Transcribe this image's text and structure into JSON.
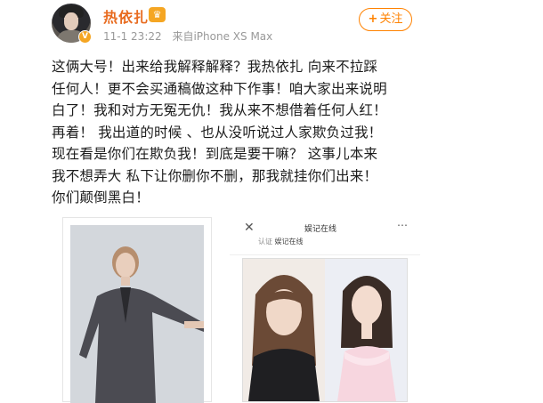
{
  "post": {
    "username": "热依扎",
    "timestamp": "11-1 23:22",
    "source": "来自iPhone XS Max",
    "follow_label": "关注",
    "text_lines": [
      "这俩大号！出来给我解释解释？我热依扎 向来不拉踩",
      "任何人！更不会买通稿做这种下作事！咱大家出来说明",
      "白了！我和对方无冤无仇！我从来不想借着任何人红！",
      "再着！ 我出道的时候 、也从没听说过人家欺负过我！",
      "现在看是你们在欺负我！到底是要干嘛？ 这事儿本来",
      "我不想弄大 私下让你删你不删，那我就挂你们出来！",
      "你们颠倒黑白！"
    ]
  },
  "screenshot": {
    "nav_title": "娱记在线",
    "sub_prefix": "认证",
    "sub_account": "娱记在线"
  },
  "colors": {
    "username": "#e86b1f",
    "follow": "#ff8200",
    "meta": "#999999"
  }
}
